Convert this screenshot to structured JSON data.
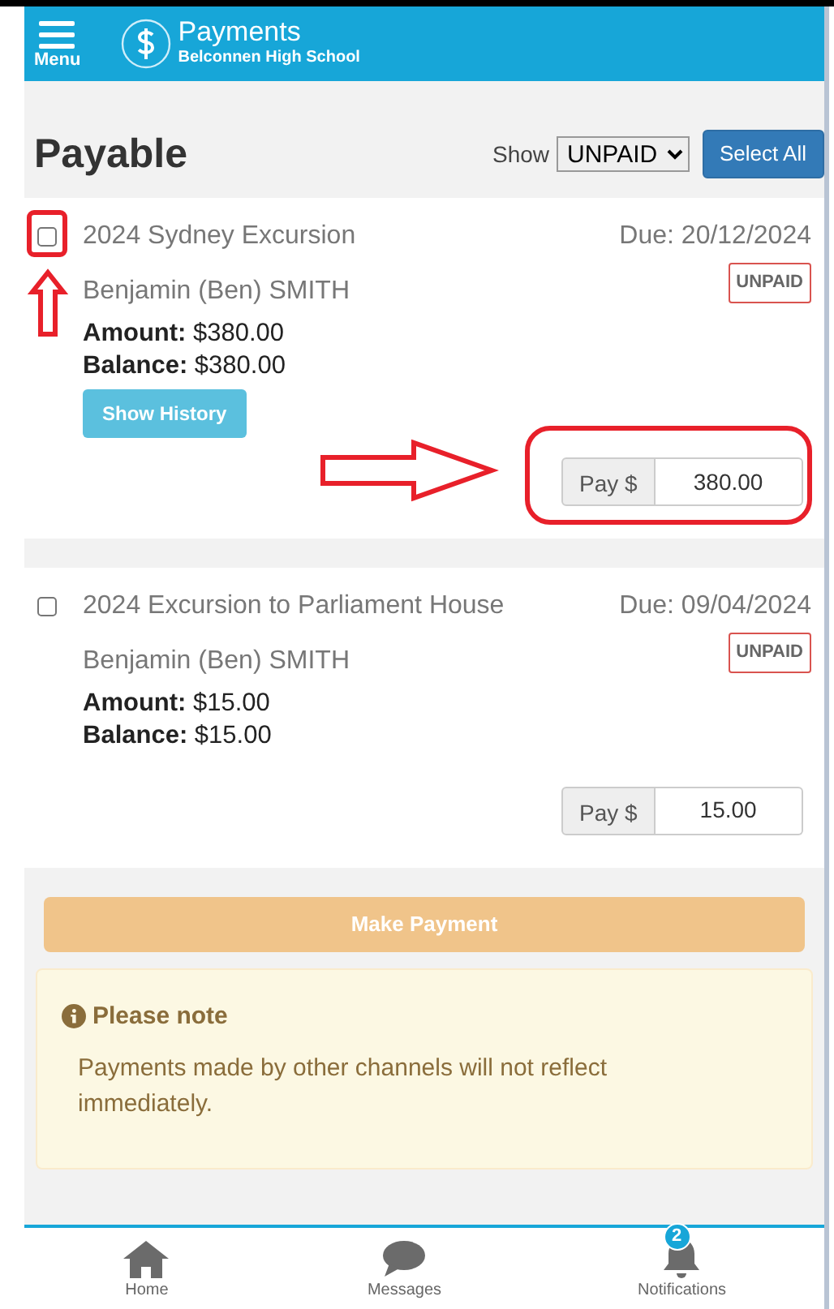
{
  "header": {
    "menu_label": "Menu",
    "title": "Payments",
    "subtitle": "Belconnen High School"
  },
  "page_title": "Payable",
  "filter": {
    "label": "Show",
    "value": "UNPAID"
  },
  "select_all": "Select All",
  "items": [
    {
      "selected": false,
      "highlighted": true,
      "title": "2024 Sydney Excursion",
      "due": "Due: 20/12/2024",
      "student": "Benjamin (Ben) SMITH",
      "status": "UNPAID",
      "amount": "**Amount:** $380.00",
      "balance": "**Balance:** $380.00",
      "history_button": "Show History",
      "pay_label": "Pay $",
      "pay_value": "380.00"
    },
    {
      "selected": false,
      "highlighted": false,
      "title": "2024 Excursion to Parliament House",
      "due": "Due: 09/04/2024",
      "student": "Benjamin (Ben) SMITH",
      "status": "UNPAID",
      "amount": "**Amount:** $15.00",
      "balance": "**Balance:** $15.00",
      "pay_label": "Pay $",
      "pay_value": "15.00"
    }
  ],
  "make_payment": {
    "label": "Make Payment",
    "disabled": true
  },
  "note": {
    "title": "Please note",
    "text": "Payments made by other channels will not reflect immediately."
  },
  "bottom_nav": [
    {
      "kind": "home",
      "label": "Home"
    },
    {
      "kind": "messages",
      "label": "Messages"
    },
    {
      "kind": "notifications",
      "label": "Notifications",
      "badge": "2"
    }
  ]
}
